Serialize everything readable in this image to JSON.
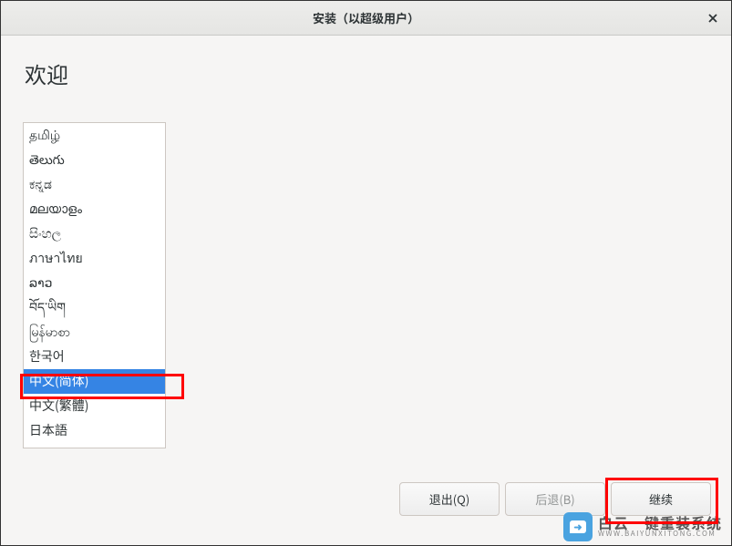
{
  "window": {
    "title": "安装（以超级用户）"
  },
  "page": {
    "welcome_title": "欢迎"
  },
  "languages": {
    "items": [
      "தமிழ்",
      "తెలుగు",
      "ಕನ್ನಡ",
      "മലയാളം",
      "සිංහල",
      "ภาษาไทย",
      "ລາວ",
      "བོད་ཡིག",
      "မြန်မာစာ",
      "한국어",
      "中文(简体)",
      "中文(繁體)",
      "日本語"
    ],
    "selected_index": 10
  },
  "footer": {
    "quit_label": "退出(Q)",
    "back_label": "后退(B)",
    "continue_label": "继续"
  },
  "watermark": {
    "main": "白云一键重装系统",
    "sub": "WWW.BAIYUNXITONG.COM"
  }
}
